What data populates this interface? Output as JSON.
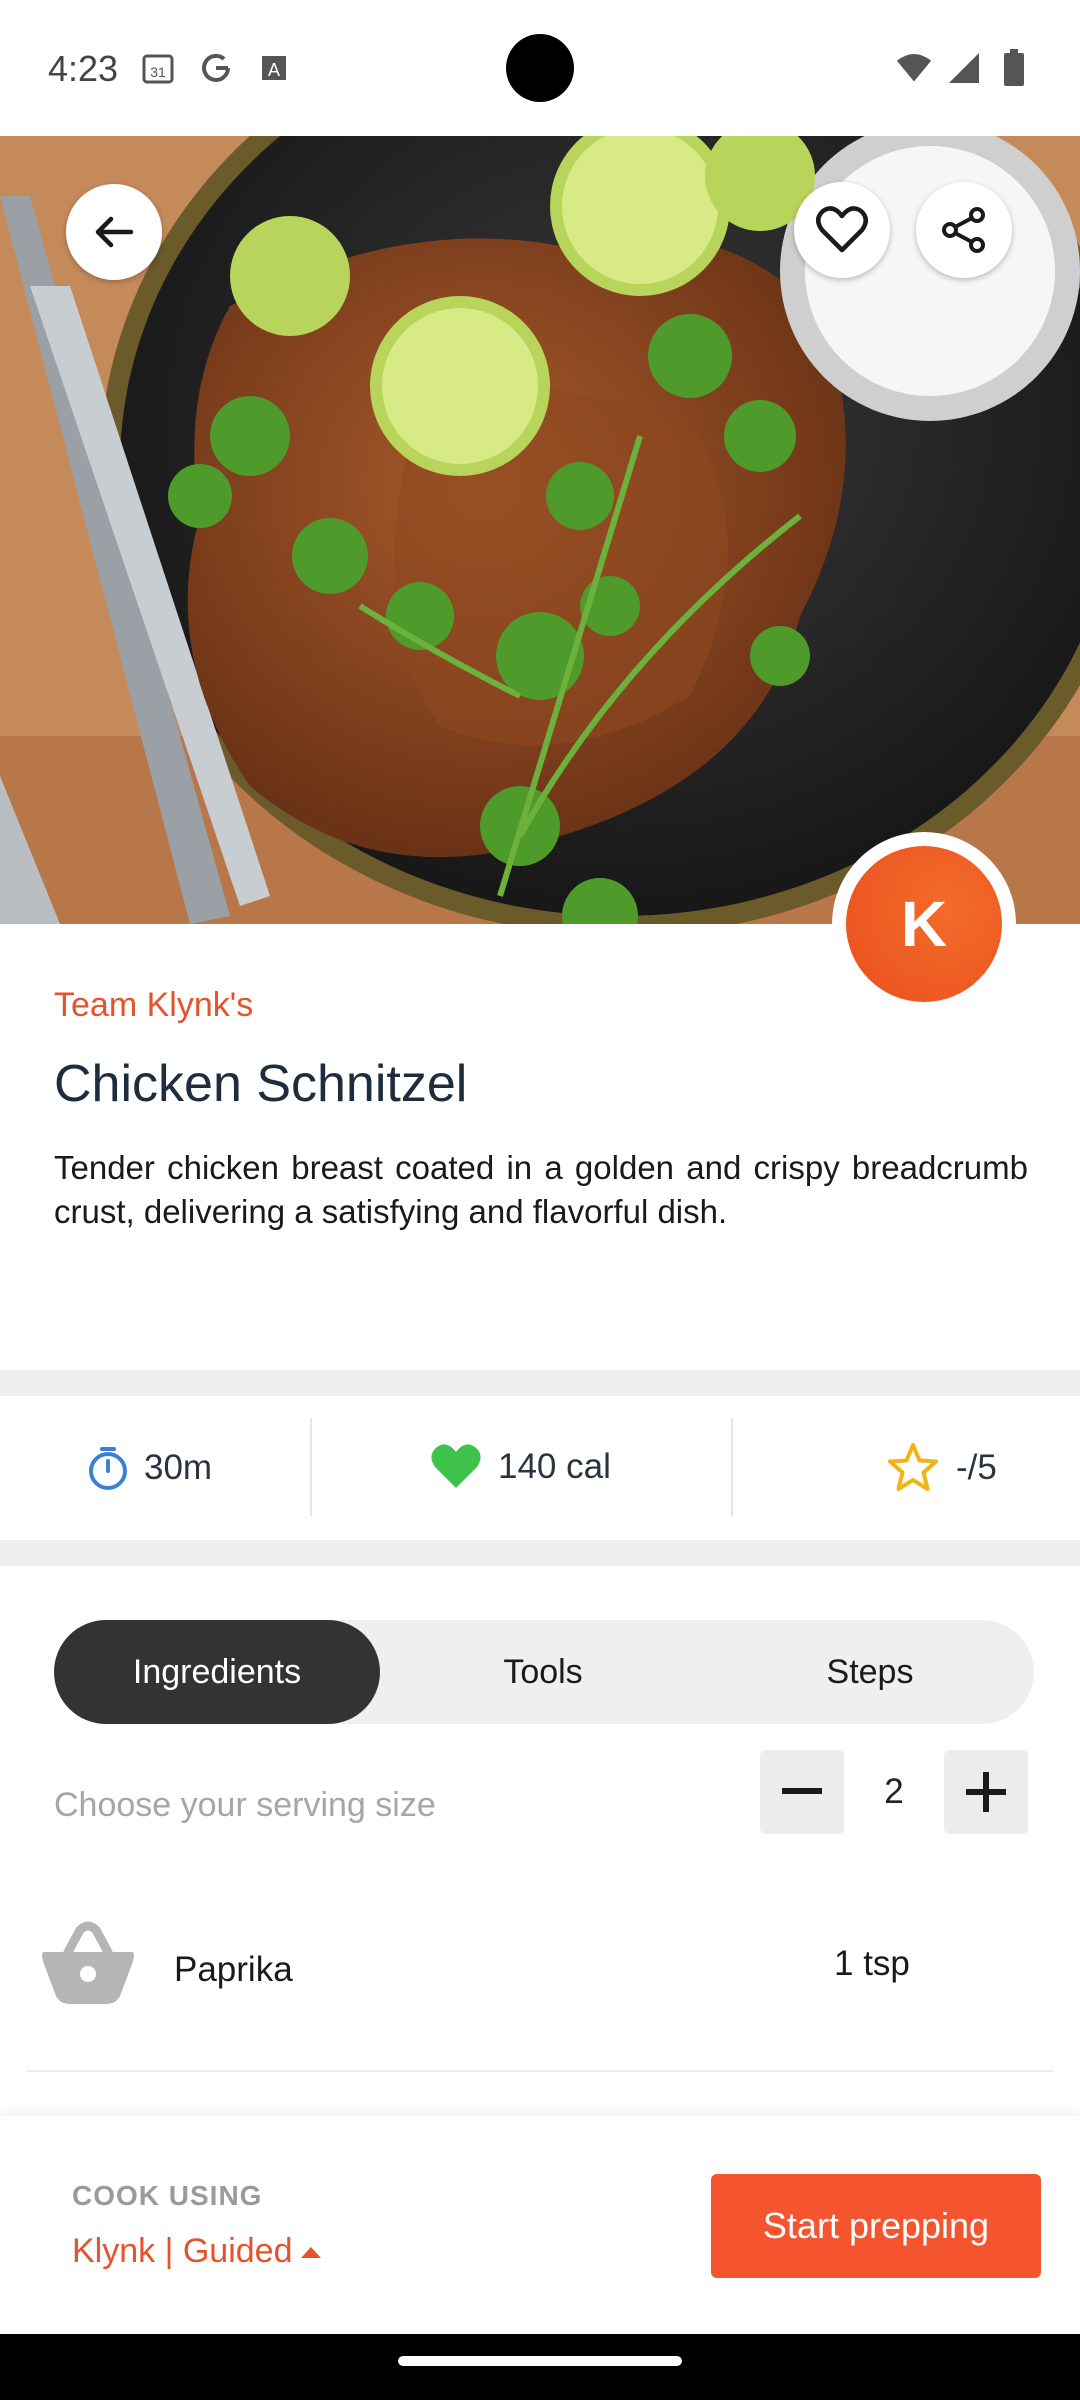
{
  "status_bar": {
    "time": "4:23",
    "icons_left": [
      "calendar-icon",
      "google-icon",
      "font-icon"
    ],
    "icons_right": [
      "wifi-icon",
      "signal-icon",
      "battery-icon"
    ]
  },
  "hero": {
    "image": "fried-chicken-schnitzel-with-lime-and-cilantro",
    "back_icon": "arrow-back-icon",
    "favorite_icon": "heart-outline-icon",
    "share_icon": "share-icon"
  },
  "author": {
    "avatar_letter": "K",
    "name": "Team Klynk's"
  },
  "recipe": {
    "title": "Chicken Schnitzel",
    "description": "Tender chicken breast coated in a golden and crispy breadcrumb crust, delivering a satisfying and flavorful dish."
  },
  "stats": {
    "time": "30m",
    "calories": "140 cal",
    "rating": "-/5"
  },
  "tabs": [
    "Ingredients",
    "Tools",
    "Steps"
  ],
  "active_tab": "Ingredients",
  "serving": {
    "label": "Choose your serving size",
    "value": "2"
  },
  "ingredients": [
    {
      "name": "Paprika",
      "quantity": "1 tsp"
    }
  ],
  "bottom_bar": {
    "cook_using_label": "COOK USING",
    "mode": "Klynk | Guided",
    "start_button": "Start prepping"
  },
  "colors": {
    "accent": "#f4552f",
    "author_text": "#e4532b",
    "active_tab_bg": "#333333",
    "calorie_heart": "#3fc24a",
    "star": "#f2b316"
  }
}
